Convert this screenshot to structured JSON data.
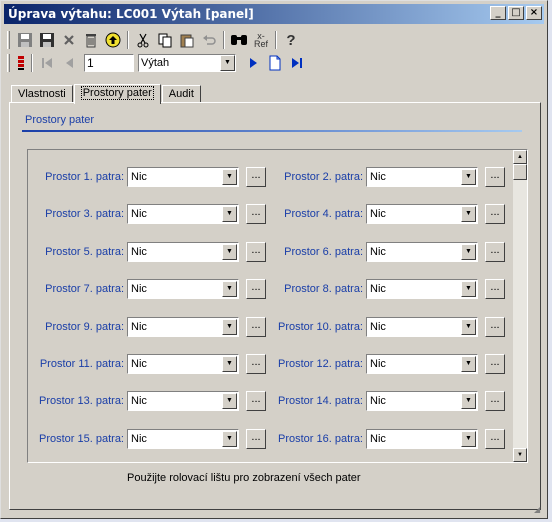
{
  "window": {
    "title": "Úprava výtahu: LC001 Výtah  [panel]",
    "min_glyph": "_",
    "max_glyph": "□",
    "close_glyph": "×"
  },
  "toolbar": {
    "icons": [
      "save-icon",
      "save-close-icon",
      "delete-x-icon",
      "trash-icon",
      "upload-icon",
      "cut-icon",
      "copy-icon",
      "paste-icon",
      "undo-icon",
      "find-icon",
      "refresh-ref-icon",
      "help-icon"
    ],
    "ref_label": "Ref",
    "help_glyph": "?"
  },
  "navigation": {
    "record_number": "1",
    "entity_value": "Výtah"
  },
  "tabs": [
    {
      "label": "Vlastnosti",
      "active": false
    },
    {
      "label": "Prostory pater",
      "active": true
    },
    {
      "label": "Audit",
      "active": false
    }
  ],
  "section": {
    "title": "Prostory pater"
  },
  "floors": [
    {
      "label": "Prostor 1. patra:",
      "value": "Nic"
    },
    {
      "label": "Prostor 2. patra:",
      "value": "Nic"
    },
    {
      "label": "Prostor 3. patra:",
      "value": "Nic"
    },
    {
      "label": "Prostor 4. patra:",
      "value": "Nic"
    },
    {
      "label": "Prostor 5. patra:",
      "value": "Nic"
    },
    {
      "label": "Prostor 6. patra:",
      "value": "Nic"
    },
    {
      "label": "Prostor 7. patra:",
      "value": "Nic"
    },
    {
      "label": "Prostor 8. patra:",
      "value": "Nic"
    },
    {
      "label": "Prostor  9. patra:",
      "value": "Nic"
    },
    {
      "label": "Prostor 10. patra:",
      "value": "Nic"
    },
    {
      "label": "Prostor 11. patra:",
      "value": "Nic"
    },
    {
      "label": "Prostor 12. patra:",
      "value": "Nic"
    },
    {
      "label": "Prostor 13. patra:",
      "value": "Nic"
    },
    {
      "label": "Prostor 14. patra:",
      "value": "Nic"
    },
    {
      "label": "Prostor 15. patra:",
      "value": "Nic"
    },
    {
      "label": "Prostor 16. patra:",
      "value": "Nic"
    }
  ],
  "ellipsis_label": "...",
  "hint": "Použijte rolovací lištu pro zobrazení všech pater",
  "colors": {
    "label_blue": "#1a3ea8",
    "title_start": "#0a246a",
    "title_end": "#a6caf0",
    "face": "#d4d0c8"
  }
}
